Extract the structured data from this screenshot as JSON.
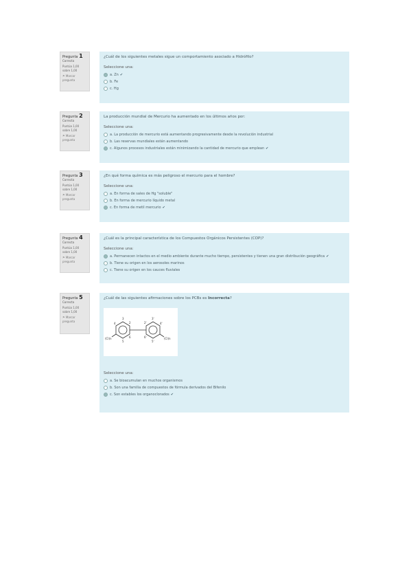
{
  "questions": [
    {
      "label": "Pregunta",
      "number": "1",
      "state": "Correcta",
      "grade_line1": "Puntúa 1,00",
      "grade_line2": "sobre 1,00",
      "flag_line1": "Marcar",
      "flag_line2": "pregunta",
      "text": "¿Cuál de los siguientes metales sigue un comportamiento asociado a Hidrófilo?",
      "prompt": "Seleccione una:",
      "answers": [
        {
          "text": "a. Zn",
          "checked": true,
          "correct": true
        },
        {
          "text": "b. Fe",
          "checked": false,
          "correct": false
        },
        {
          "text": "c. Hg",
          "checked": false,
          "correct": false
        }
      ]
    },
    {
      "label": "Pregunta",
      "number": "2",
      "state": "Correcta",
      "grade_line1": "Puntúa 1,00",
      "grade_line2": "sobre 1,00",
      "flag_line1": "Marcar",
      "flag_line2": "pregunta",
      "text": "La producción mundial de Mercurio ha aumentado en los últimos años por:",
      "prompt": "Seleccione una:",
      "answers": [
        {
          "text": "a. La producción de mercurio está aumentando progresivamente desde la revolución industrial",
          "checked": false,
          "correct": false
        },
        {
          "text": "b. Las reservas mundiales están aumentando",
          "checked": false,
          "correct": false
        },
        {
          "text": "c. Algunos procesos industriales están minimizando la cantidad de mercurio que emplean",
          "checked": true,
          "correct": true
        }
      ]
    },
    {
      "label": "Pregunta",
      "number": "3",
      "state": "Correcta",
      "grade_line1": "Puntúa 1,00",
      "grade_line2": "sobre 1,00",
      "flag_line1": "Marcar",
      "flag_line2": "pregunta",
      "text": "¿En qué forma química es más peligroso el mercurio para el hombre?",
      "prompt": "Seleccione una:",
      "answers": [
        {
          "text": "a. En forma de sales de Hg \"soluble\"",
          "checked": false,
          "correct": false
        },
        {
          "text": "b. En forma de mercurio líquido metal",
          "checked": false,
          "correct": false
        },
        {
          "text": "c. En forma de metil mercurio",
          "checked": true,
          "correct": true
        }
      ]
    },
    {
      "label": "Pregunta",
      "number": "4",
      "state": "Correcta",
      "grade_line1": "Puntúa 1,00",
      "grade_line2": "sobre 1,00",
      "flag_line1": "Marcar",
      "flag_line2": "pregunta",
      "text": "¿Cuál es la principal característica de los Compuestos Orgánicos Persistentes (COP)?",
      "prompt": "Seleccione una:",
      "answers": [
        {
          "text": "a. Permanecen intactos en el medio ambiente durante mucho tiempo, persistentes y tienen una gran distribución geográfica",
          "checked": true,
          "correct": true
        },
        {
          "text": "b. Tiene su origen en los aerosoles marinos",
          "checked": false,
          "correct": false
        },
        {
          "text": "c. Tiene su origen en los cauces fluviales",
          "checked": false,
          "correct": false
        }
      ]
    },
    {
      "label": "Pregunta",
      "number": "5",
      "state": "Correcta",
      "grade_line1": "Puntúa 1,00",
      "grade_line2": "sobre 1,00",
      "flag_line1": "Marcar",
      "flag_line2": "pregunta",
      "text_pre": "¿Cuál de las siguientes afirmaciones sobre los PCBs es ",
      "text_bold": "Incorrecta",
      "text_post": "?",
      "figure_labels": {
        "left_group": "(Cl)n",
        "right_group": "(Cl)n",
        "l2": "2",
        "l3": "3",
        "l4": "4",
        "l5": "5",
        "l6": "6",
        "r2": "2'",
        "r3": "3'",
        "r4": "4'",
        "r5": "5'",
        "r6": "6'"
      },
      "prompt": "Seleccione una:",
      "answers": [
        {
          "text": "a. Se bioacumulan en muchos organismos",
          "checked": false,
          "correct": false
        },
        {
          "text": "b. Son una familia de compuestos de fórmula derivados del Bifenilo",
          "checked": false,
          "correct": false
        },
        {
          "text": "c. Son estables los organoclorados",
          "checked": true,
          "correct": true
        }
      ]
    }
  ],
  "icons": {
    "tick": "✔",
    "flag": "⚑"
  },
  "colors": {
    "content_bg": "#dceff5",
    "info_bg": "#e6e6e6"
  }
}
